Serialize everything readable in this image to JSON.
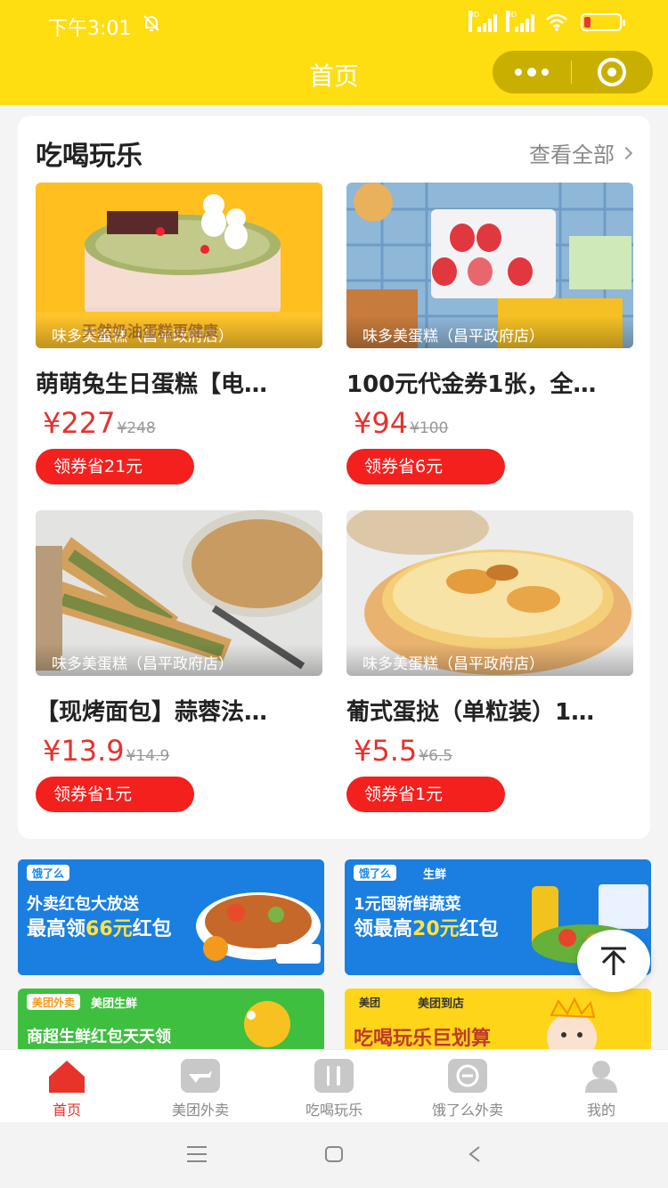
{
  "status_bar": {
    "time": "下午3:01",
    "signal_label": "HD"
  },
  "header": {
    "title": "首页"
  },
  "section": {
    "title": "吃喝玩乐",
    "view_all": "查看全部"
  },
  "products": [
    {
      "shop": "味多美蛋糕（昌平政府店）",
      "name": "萌萌兔生日蛋糕【电…",
      "price": "¥227",
      "original_price": "¥248",
      "coupon": "领券省21元",
      "img_caption": "天然奶油蛋糕更健康"
    },
    {
      "shop": "味多美蛋糕（昌平政府店）",
      "name": "100元代金券1张，全…",
      "price": "¥94",
      "original_price": "¥100",
      "coupon": "领券省6元"
    },
    {
      "shop": "味多美蛋糕（昌平政府店）",
      "name": "【现烤面包】蒜蓉法…",
      "price": "¥13.9",
      "original_price": "¥14.9",
      "coupon": "领券省1元"
    },
    {
      "shop": "味多美蛋糕（昌平政府店）",
      "name": "葡式蛋挞（单粒装）1…",
      "price": "¥5.5",
      "original_price": "¥6.5",
      "coupon": "领券省1元"
    }
  ],
  "banners": [
    {
      "brand": "饿了么",
      "line1": "外卖红包大放送",
      "line2_prefix": "最高领",
      "line2_highlight": "66元",
      "line2_suffix": "红包"
    },
    {
      "brand": "饿了么",
      "brand2": "生鲜",
      "line1": "1元囤新鲜蔬菜",
      "line2_prefix": "领最高",
      "line2_highlight": "20元",
      "line2_suffix": "红包"
    },
    {
      "brand": "美团外卖",
      "brand2": "美团生鲜",
      "line1": "商超生鲜红包天天领"
    },
    {
      "brand": "美团",
      "brand2": "美团到店",
      "line1": "吃喝玩乐巨划算"
    }
  ],
  "tabs": [
    {
      "label": "首页",
      "icon": "home-icon"
    },
    {
      "label": "美团外卖",
      "icon": "meituan-icon"
    },
    {
      "label": "吃喝玩乐",
      "icon": "fork-knife-icon"
    },
    {
      "label": "饿了么外卖",
      "icon": "eleme-icon"
    },
    {
      "label": "我的",
      "icon": "user-icon"
    }
  ],
  "colors": {
    "header": "#fede10",
    "price": "#e5322d",
    "coupon": "#f3201d",
    "tab_active": "#e5322d"
  }
}
